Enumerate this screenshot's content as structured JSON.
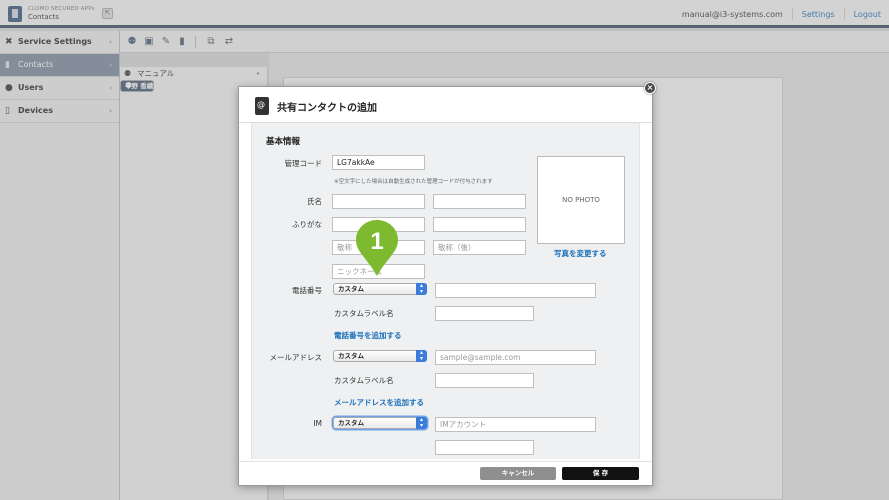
{
  "app": {
    "name": "CLOMO SECURED APPs",
    "subtitle": "Contacts"
  },
  "header": {
    "user": "manual@i3-systems.com",
    "settings": "Settings",
    "logout": "Logout"
  },
  "sidebar": {
    "items": [
      {
        "label": "Service Settings",
        "icon": "tools-icon"
      },
      {
        "label": "Contacts",
        "icon": "contacts-icon"
      },
      {
        "label": "Users",
        "icon": "user-icon"
      },
      {
        "label": "Devices",
        "icon": "device-icon"
      }
    ],
    "active": "Contacts",
    "chevron": "›"
  },
  "toolbar": {
    "icons": [
      "add-user-icon",
      "add-contact-icon",
      "edit-icon",
      "delete-icon",
      "copy-icon",
      "sync-icon"
    ]
  },
  "list": {
    "items": [
      {
        "label": "マニュアル",
        "icon": "group-icon"
      },
      {
        "label": "平野 香織",
        "icon": "group-icon"
      }
    ]
  },
  "modal": {
    "title": "共有コンタクトの追加",
    "close": "×",
    "section": "基本情報",
    "fields": {
      "code_label": "管理コード",
      "code_value": "LG7akkAe",
      "code_note": "※空文字にした場合は自動生成された管理コードが付与されます",
      "name_label": "氏名",
      "kana_label": "ふりがな",
      "honorific_first_placeholder": "敬称",
      "honorific_last_placeholder": "敬称（後）",
      "nickname_placeholder": "ニックネーム",
      "phone_label": "電話番号",
      "phone_type": "カスタム",
      "custom_label_1": "カスタムラベル名",
      "add_phone": "電話番号を追加する",
      "email_label": "メールアドレス",
      "email_type": "カスタム",
      "email_placeholder": "sample@sample.com",
      "custom_label_2": "カスタムラベル名",
      "add_email": "メールアドレスを追加する",
      "im_label": "IM",
      "im_type": "カスタム",
      "im_placeholder": "IMアカウント"
    },
    "photo": {
      "placeholder": "NO PHOTO",
      "change": "写真を変更する"
    },
    "buttons": {
      "cancel": "キャンセル",
      "save": "保 存"
    }
  },
  "callout": {
    "number": "1",
    "color": "#7dba2f"
  }
}
